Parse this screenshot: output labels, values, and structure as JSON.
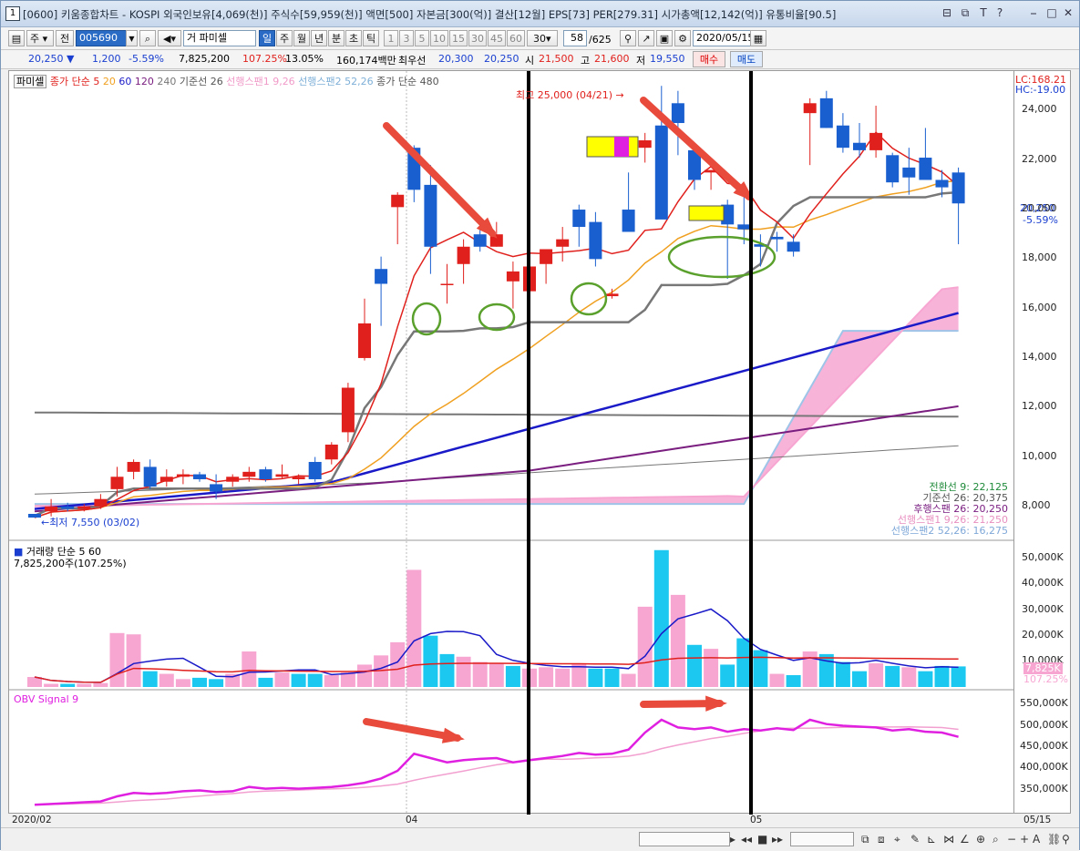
{
  "window": {
    "number": "1",
    "title": "[0600] 키움종합차트 - KOSPI 외국인보유[4,069(천)] 주식수[59,959(천)] 액면[500] 자본금[300(억)] 결산[12월] EPS[73] PER[279.31] 시가총액[12,142(억)] 유통비율[90.5]",
    "controls": [
      "⊟",
      "⧉",
      "T",
      "?",
      "⎯",
      "□",
      "✕"
    ]
  },
  "toolbar": {
    "type_select": "주",
    "prev_label": "전",
    "code": "005690",
    "name": "거 파미셀",
    "periods": [
      "일",
      "주",
      "월",
      "년",
      "분",
      "초",
      "틱"
    ],
    "selected_period": "일",
    "intervals": [
      "1",
      "3",
      "5",
      "10",
      "15",
      "30",
      "45",
      "60"
    ],
    "interval_value": "30",
    "count": "58",
    "total": "/625",
    "date": "2020/05/15"
  },
  "quote": {
    "price": "20,250",
    "change": "1,200",
    "pct": "-5.59%",
    "volume": "7,825,200",
    "vol_ratio": "107.25%",
    "turnover": "13.05%",
    "amount": "160,174백만",
    "best": "최우선",
    "bid": "20,300",
    "ask": "20,250",
    "open_label": "시",
    "open": "21,500",
    "high_label": "고",
    "high": "21,600",
    "low_label": "저",
    "low": "19,550",
    "buy": "매수",
    "sell": "매도"
  },
  "legend": {
    "name": "파미셀",
    "close": "종가 단순",
    "ma5": "5",
    "ma20": "20",
    "ma60": "60",
    "ma120": "120",
    "ma240": "240",
    "kijun": "기준선 26",
    "spanA": "선행스팬1 9,26",
    "spanB": "선행스팬2 52,26",
    "close480": "종가 단순 480"
  },
  "annotations": {
    "max": "최고 25,000 (04/21) →",
    "min": "←최저 7,550 (03/02)",
    "lc": "LC:168.21",
    "hc": "HC:-19.00",
    "cur_price": "20,250",
    "cur_pct": "-5.59%"
  },
  "ichimoku_labels": [
    {
      "text": "전환선 9: 22,125",
      "color": "#1f8a3a"
    },
    {
      "text": "기준선 26: 20,375",
      "color": "#555555"
    },
    {
      "text": "후행스팬 26: 20,250",
      "color": "#7a1e80"
    },
    {
      "text": "선행스팬1 9,26: 21,250",
      "color": "#e890c0"
    },
    {
      "text": "선행스팬2 52,26: 16,275",
      "color": "#7fa8d8"
    }
  ],
  "price_axis": [
    "24,000",
    "22,000",
    "20,000",
    "18,000",
    "16,000",
    "14,000",
    "12,000",
    "10,000",
    "8,000"
  ],
  "volume_panel": {
    "title": "거래량 단순 5 60",
    "value": "7,825,200주(107.25%)",
    "axis": [
      "50,000K",
      "40,000K",
      "30,000K",
      "20,000K",
      "10,000K"
    ],
    "cur": "7,825K",
    "cur_pct": "107.25%"
  },
  "obv_panel": {
    "title": "OBV Signal 9",
    "axis": [
      "550,000K",
      "500,000K",
      "450,000K",
      "400,000K",
      "350,000K"
    ]
  },
  "x_axis": [
    "2020/02",
    "04",
    "05",
    "05/15"
  ],
  "colors": {
    "up": "#e0201c",
    "down": "#1a5fd0",
    "ma5": "#e0201c",
    "ma20": "#f0a020",
    "ma60": "#1a1ac8",
    "ma120": "#7a1e80",
    "kijun": "#777777",
    "cloud": "#f7a6d2",
    "obv": "#e020e0",
    "signal": "#f2a0d0"
  },
  "candles": [
    [
      7700,
      7700,
      7550,
      7550
    ],
    [
      7800,
      8300,
      7600,
      8000
    ],
    [
      8000,
      8150,
      7800,
      7900
    ],
    [
      7900,
      8100,
      7800,
      8000
    ],
    [
      8000,
      8500,
      7900,
      8300
    ],
    [
      8700,
      9600,
      8400,
      9200
    ],
    [
      9400,
      9900,
      9100,
      9800
    ],
    [
      9600,
      9900,
      8700,
      8800
    ],
    [
      9000,
      9500,
      8800,
      9200
    ],
    [
      9200,
      9500,
      8900,
      9300
    ],
    [
      9300,
      9400,
      9000,
      9100
    ],
    [
      8900,
      9300,
      8300,
      8600
    ],
    [
      9000,
      9300,
      8800,
      9200
    ],
    [
      9200,
      9600,
      9000,
      9400
    ],
    [
      9500,
      9600,
      9000,
      9100
    ],
    [
      9200,
      9700,
      9100,
      9300
    ],
    [
      9100,
      9300,
      8900,
      9200
    ],
    [
      9800,
      10000,
      9000,
      9100
    ],
    [
      9900,
      10600,
      9700,
      10500
    ],
    [
      11000,
      13000,
      10600,
      12800
    ],
    [
      14000,
      16400,
      13900,
      15400
    ],
    [
      17600,
      18100,
      15300,
      17000
    ],
    [
      20100,
      20700,
      18600,
      20600
    ],
    [
      22500,
      22600,
      20300,
      20800
    ],
    [
      21000,
      21800,
      17400,
      18500
    ],
    [
      17000,
      17800,
      16200,
      17000
    ],
    [
      17800,
      18800,
      17000,
      18500
    ],
    [
      19000,
      19500,
      18300,
      18500
    ],
    [
      18500,
      19500,
      18500,
      19000
    ],
    [
      17100,
      17900,
      16000,
      17500
    ],
    [
      16700,
      17900,
      16300,
      17700
    ],
    [
      17800,
      18300,
      17000,
      18400
    ],
    [
      18500,
      19300,
      17900,
      18800
    ],
    [
      20000,
      20200,
      18500,
      19300
    ],
    [
      19500,
      19900,
      17700,
      18000
    ],
    [
      16500,
      16800,
      16400,
      16600
    ],
    [
      20000,
      21500,
      19900,
      19100
    ],
    [
      22500,
      23100,
      21900,
      22800
    ],
    [
      23400,
      25000,
      20200,
      19600
    ],
    [
      24300,
      24800,
      22200,
      23500
    ],
    [
      22400,
      22500,
      20800,
      21200
    ],
    [
      21500,
      21600,
      20800,
      21600
    ],
    [
      20200,
      20400,
      17200,
      19400
    ],
    [
      19400,
      20800,
      18600,
      19200
    ],
    [
      18600,
      19000,
      17700,
      18500
    ],
    [
      18900,
      19100,
      18300,
      18800
    ],
    [
      18700,
      19000,
      18100,
      18300
    ],
    [
      23900,
      24500,
      21800,
      24300
    ],
    [
      24500,
      24800,
      23300,
      23300
    ],
    [
      23400,
      23900,
      22300,
      22500
    ],
    [
      22700,
      23500,
      22100,
      22400
    ],
    [
      22400,
      24200,
      22100,
      23100
    ],
    [
      22200,
      22300,
      20900,
      21100
    ],
    [
      21700,
      22500,
      20600,
      21300
    ],
    [
      22100,
      23300,
      21300,
      21200
    ],
    [
      21200,
      21600,
      20500,
      20900
    ],
    [
      21500,
      21700,
      18600,
      20250
    ]
  ],
  "volumes": [
    3800,
    1200,
    1200,
    1200,
    1500,
    20500,
    20000,
    6000,
    5000,
    3000,
    3500,
    3000,
    5000,
    13500,
    3500,
    5500,
    5000,
    5000,
    4500,
    5500,
    8500,
    12000,
    17000,
    44500,
    19500,
    12500,
    11500,
    9500,
    9000,
    8000,
    7000,
    7500,
    7000,
    9000,
    7000,
    7000,
    5000,
    30500,
    52000,
    35000,
    16000,
    14500,
    8500,
    18500,
    14000,
    5000,
    4500,
    13500,
    12500,
    9500,
    6000,
    9000,
    8000,
    7500,
    6000,
    8000,
    7825
  ],
  "obv": [
    310,
    312,
    314,
    316,
    318,
    330,
    338,
    336,
    338,
    342,
    344,
    340,
    342,
    352,
    348,
    350,
    348,
    350,
    352,
    356,
    362,
    372,
    390,
    430,
    420,
    410,
    415,
    418,
    420,
    410,
    415,
    420,
    425,
    432,
    428,
    430,
    440,
    480,
    510,
    492,
    488,
    492,
    482,
    488,
    485,
    490,
    486,
    510,
    500,
    496,
    494,
    492,
    485,
    488,
    482,
    480,
    470
  ]
}
